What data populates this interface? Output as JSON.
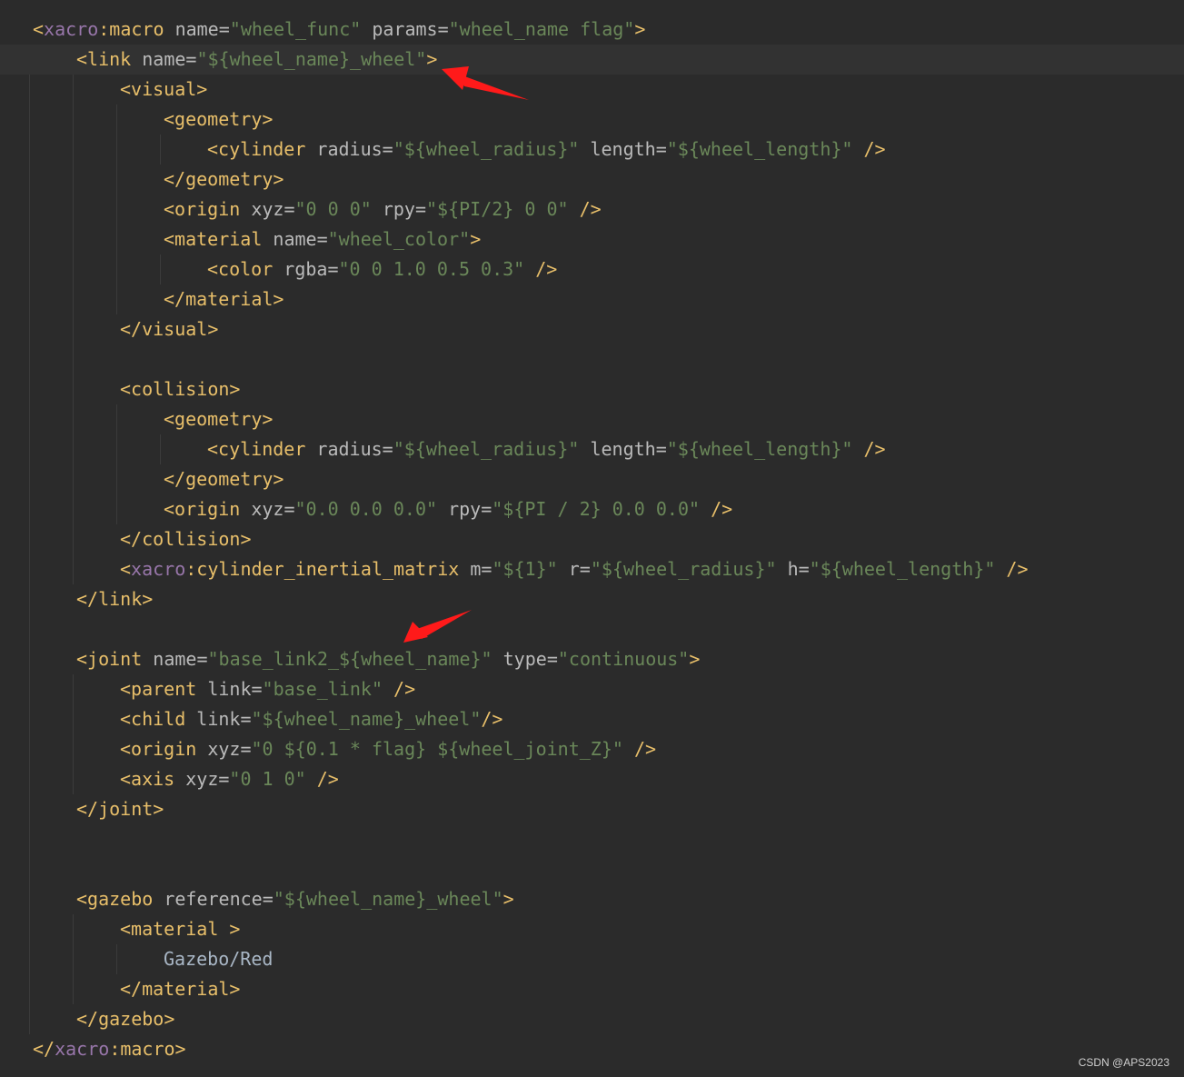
{
  "editor": {
    "lines": [
      {
        "indent": 0,
        "current": false,
        "tokens": [
          [
            "tag",
            "<"
          ],
          [
            "ns",
            "xacro"
          ],
          [
            "tag",
            ":macro "
          ],
          [
            "attr",
            "name"
          ],
          [
            "eq",
            "="
          ],
          [
            "val",
            "\"wheel_func\""
          ],
          [
            "attr",
            " params"
          ],
          [
            "eq",
            "="
          ],
          [
            "val",
            "\"wheel_name flag\""
          ],
          [
            "tag",
            ">"
          ]
        ]
      },
      {
        "indent": 1,
        "current": true,
        "tokens": [
          [
            "tag",
            "<link "
          ],
          [
            "attr",
            "name"
          ],
          [
            "eq",
            "="
          ],
          [
            "val",
            "\"${wheel_name}_wheel\""
          ],
          [
            "tag",
            ">"
          ]
        ]
      },
      {
        "indent": 2,
        "current": false,
        "tokens": [
          [
            "tag",
            "<visual>"
          ]
        ]
      },
      {
        "indent": 3,
        "current": false,
        "tokens": [
          [
            "tag",
            "<geometry>"
          ]
        ]
      },
      {
        "indent": 4,
        "current": false,
        "tokens": [
          [
            "tag",
            "<cylinder "
          ],
          [
            "attr",
            "radius"
          ],
          [
            "eq",
            "="
          ],
          [
            "val",
            "\"${wheel_radius}\""
          ],
          [
            "attr",
            " length"
          ],
          [
            "eq",
            "="
          ],
          [
            "val",
            "\"${wheel_length}\""
          ],
          [
            "tag",
            " />"
          ]
        ]
      },
      {
        "indent": 3,
        "current": false,
        "tokens": [
          [
            "tag",
            "</geometry>"
          ]
        ]
      },
      {
        "indent": 3,
        "current": false,
        "tokens": [
          [
            "tag",
            "<origin "
          ],
          [
            "attr",
            "xyz"
          ],
          [
            "eq",
            "="
          ],
          [
            "val",
            "\"0 0 0\""
          ],
          [
            "attr",
            " rpy"
          ],
          [
            "eq",
            "="
          ],
          [
            "val",
            "\"${PI/2} 0 0\""
          ],
          [
            "tag",
            " />"
          ]
        ]
      },
      {
        "indent": 3,
        "current": false,
        "tokens": [
          [
            "tag",
            "<material "
          ],
          [
            "attr",
            "name"
          ],
          [
            "eq",
            "="
          ],
          [
            "val",
            "\"wheel_color\""
          ],
          [
            "tag",
            ">"
          ]
        ]
      },
      {
        "indent": 4,
        "current": false,
        "tokens": [
          [
            "tag",
            "<color "
          ],
          [
            "attr",
            "rgba"
          ],
          [
            "eq",
            "="
          ],
          [
            "val",
            "\"0 0 1.0 0.5 0.3\""
          ],
          [
            "tag",
            " />"
          ]
        ]
      },
      {
        "indent": 3,
        "current": false,
        "tokens": [
          [
            "tag",
            "</material>"
          ]
        ]
      },
      {
        "indent": 2,
        "current": false,
        "tokens": [
          [
            "tag",
            "</visual>"
          ]
        ]
      },
      {
        "indent": 0,
        "current": false,
        "tokens": []
      },
      {
        "indent": 2,
        "current": false,
        "tokens": [
          [
            "tag",
            "<collision>"
          ]
        ]
      },
      {
        "indent": 3,
        "current": false,
        "tokens": [
          [
            "tag",
            "<geometry>"
          ]
        ]
      },
      {
        "indent": 4,
        "current": false,
        "tokens": [
          [
            "tag",
            "<cylinder "
          ],
          [
            "attr",
            "radius"
          ],
          [
            "eq",
            "="
          ],
          [
            "val",
            "\"${wheel_radius}\""
          ],
          [
            "attr",
            " length"
          ],
          [
            "eq",
            "="
          ],
          [
            "val",
            "\"${wheel_length}\""
          ],
          [
            "tag",
            " />"
          ]
        ]
      },
      {
        "indent": 3,
        "current": false,
        "tokens": [
          [
            "tag",
            "</geometry>"
          ]
        ]
      },
      {
        "indent": 3,
        "current": false,
        "tokens": [
          [
            "tag",
            "<origin "
          ],
          [
            "attr",
            "xyz"
          ],
          [
            "eq",
            "="
          ],
          [
            "val",
            "\"0.0 0.0 0.0\""
          ],
          [
            "attr",
            " rpy"
          ],
          [
            "eq",
            "="
          ],
          [
            "val",
            "\"${PI / 2} 0.0 0.0\""
          ],
          [
            "tag",
            " />"
          ]
        ]
      },
      {
        "indent": 2,
        "current": false,
        "tokens": [
          [
            "tag",
            "</collision>"
          ]
        ]
      },
      {
        "indent": 2,
        "current": false,
        "tokens": [
          [
            "tag",
            "<"
          ],
          [
            "ns",
            "xacro"
          ],
          [
            "tag",
            ":cylinder_inertial_matrix "
          ],
          [
            "attr",
            "m"
          ],
          [
            "eq",
            "="
          ],
          [
            "val",
            "\"${1}\""
          ],
          [
            "attr",
            " r"
          ],
          [
            "eq",
            "="
          ],
          [
            "val",
            "\"${wheel_radius}\""
          ],
          [
            "attr",
            " h"
          ],
          [
            "eq",
            "="
          ],
          [
            "val",
            "\"${wheel_length}\""
          ],
          [
            "tag",
            " />"
          ]
        ]
      },
      {
        "indent": 1,
        "current": false,
        "tokens": [
          [
            "tag",
            "</link>"
          ]
        ]
      },
      {
        "indent": 0,
        "current": false,
        "tokens": []
      },
      {
        "indent": 1,
        "current": false,
        "tokens": [
          [
            "tag",
            "<joint "
          ],
          [
            "attr",
            "name"
          ],
          [
            "eq",
            "="
          ],
          [
            "val",
            "\"base_link2_${wheel_name}\""
          ],
          [
            "attr",
            " type"
          ],
          [
            "eq",
            "="
          ],
          [
            "val",
            "\"continuous\""
          ],
          [
            "tag",
            ">"
          ]
        ]
      },
      {
        "indent": 2,
        "current": false,
        "tokens": [
          [
            "tag",
            "<parent "
          ],
          [
            "attr",
            "link"
          ],
          [
            "eq",
            "="
          ],
          [
            "val",
            "\"base_link\""
          ],
          [
            "tag",
            " />"
          ]
        ]
      },
      {
        "indent": 2,
        "current": false,
        "tokens": [
          [
            "tag",
            "<child "
          ],
          [
            "attr",
            "link"
          ],
          [
            "eq",
            "="
          ],
          [
            "val",
            "\"${wheel_name}_wheel\""
          ],
          [
            "tag",
            "/>"
          ]
        ]
      },
      {
        "indent": 2,
        "current": false,
        "tokens": [
          [
            "tag",
            "<origin "
          ],
          [
            "attr",
            "xyz"
          ],
          [
            "eq",
            "="
          ],
          [
            "val",
            "\"0 ${0.1 * flag} ${wheel_joint_Z}\""
          ],
          [
            "tag",
            " />"
          ]
        ]
      },
      {
        "indent": 2,
        "current": false,
        "tokens": [
          [
            "tag",
            "<axis "
          ],
          [
            "attr",
            "xyz"
          ],
          [
            "eq",
            "="
          ],
          [
            "val",
            "\"0 1 0\""
          ],
          [
            "tag",
            " />"
          ]
        ]
      },
      {
        "indent": 1,
        "current": false,
        "tokens": [
          [
            "tag",
            "</joint>"
          ]
        ]
      },
      {
        "indent": 0,
        "current": false,
        "tokens": []
      },
      {
        "indent": 0,
        "current": false,
        "tokens": []
      },
      {
        "indent": 1,
        "current": false,
        "tokens": [
          [
            "tag",
            "<gazebo "
          ],
          [
            "attr",
            "reference"
          ],
          [
            "eq",
            "="
          ],
          [
            "val",
            "\"${wheel_name}_wheel\""
          ],
          [
            "tag",
            ">"
          ]
        ]
      },
      {
        "indent": 2,
        "current": false,
        "tokens": [
          [
            "tag",
            "<material >"
          ]
        ]
      },
      {
        "indent": 3,
        "current": false,
        "tokens": [
          [
            "text",
            "Gazebo/Red"
          ]
        ]
      },
      {
        "indent": 2,
        "current": false,
        "tokens": [
          [
            "tag",
            "</material>"
          ]
        ]
      },
      {
        "indent": 1,
        "current": false,
        "tokens": [
          [
            "tag",
            "</gazebo>"
          ]
        ]
      },
      {
        "indent": 0,
        "current": false,
        "tokens": [
          [
            "tag",
            "</"
          ],
          [
            "ns",
            "xacro"
          ],
          [
            "tag",
            ":macro>"
          ]
        ]
      }
    ]
  },
  "annotations": [
    {
      "name": "red-arrow-link-name"
    },
    {
      "name": "red-arrow-joint-name"
    }
  ],
  "watermark": "CSDN @APS2023",
  "colors": {
    "background": "#2b2b2b",
    "tag": "#e8bf6a",
    "attribute": "#bababa",
    "value": "#6a8759",
    "namespace": "#9876aa",
    "text": "#a9b7c6",
    "arrow": "#ff1a1a"
  }
}
